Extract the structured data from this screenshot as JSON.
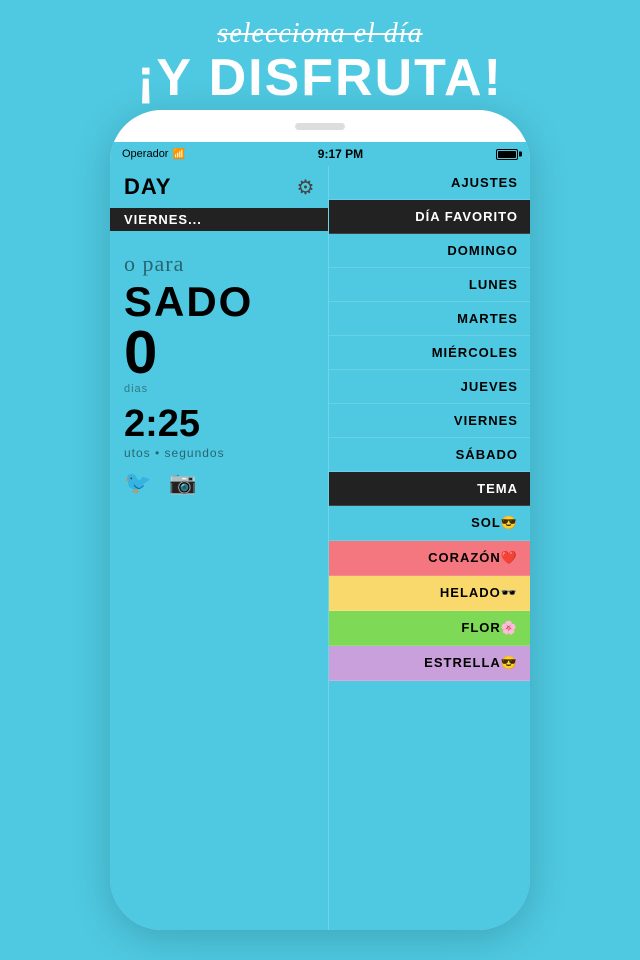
{
  "background_color": "#4ec9e1",
  "top": {
    "subtitle": "selecciona el día",
    "title": "¡Y DISFRUTA!"
  },
  "phone": {
    "status_bar": {
      "carrier": "Operador",
      "time": "9:17 PM"
    },
    "left_pane": {
      "title": "DAY",
      "gear_symbol": "⚙",
      "selected_day": "VIERNES...",
      "para_text": "o para",
      "day_big": "SADO",
      "number": "0",
      "time_label": "2:25",
      "time_sub": "utos • segundos",
      "icon_twitter": "🐦",
      "icon_camera": "📷"
    },
    "right_pane": {
      "items": [
        {
          "label": "AJUSTES",
          "type": "normal",
          "emoji": ""
        },
        {
          "label": "DÍA FAVORITO",
          "type": "section-header",
          "emoji": ""
        },
        {
          "label": "DOMINGO",
          "type": "normal",
          "emoji": ""
        },
        {
          "label": "LUNES",
          "type": "normal",
          "emoji": ""
        },
        {
          "label": "MARTES",
          "type": "normal",
          "emoji": ""
        },
        {
          "label": "MIÉRCOLES",
          "type": "normal",
          "emoji": ""
        },
        {
          "label": "JUEVES",
          "type": "normal",
          "emoji": ""
        },
        {
          "label": "VIERNES",
          "type": "normal",
          "emoji": ""
        },
        {
          "label": "SÁBADO",
          "type": "normal",
          "emoji": ""
        },
        {
          "label": "TEMA",
          "type": "section-header",
          "emoji": ""
        },
        {
          "label": "SOL",
          "type": "sol",
          "emoji": "😎"
        },
        {
          "label": "CORAZÓN",
          "type": "corazon",
          "emoji": "❤️"
        },
        {
          "label": "HELADO",
          "type": "helado",
          "emoji": "🕶️"
        },
        {
          "label": "FLOR",
          "type": "flor",
          "emoji": "🌸"
        },
        {
          "label": "ESTRELLA",
          "type": "estrella",
          "emoji": "😎"
        }
      ]
    }
  }
}
